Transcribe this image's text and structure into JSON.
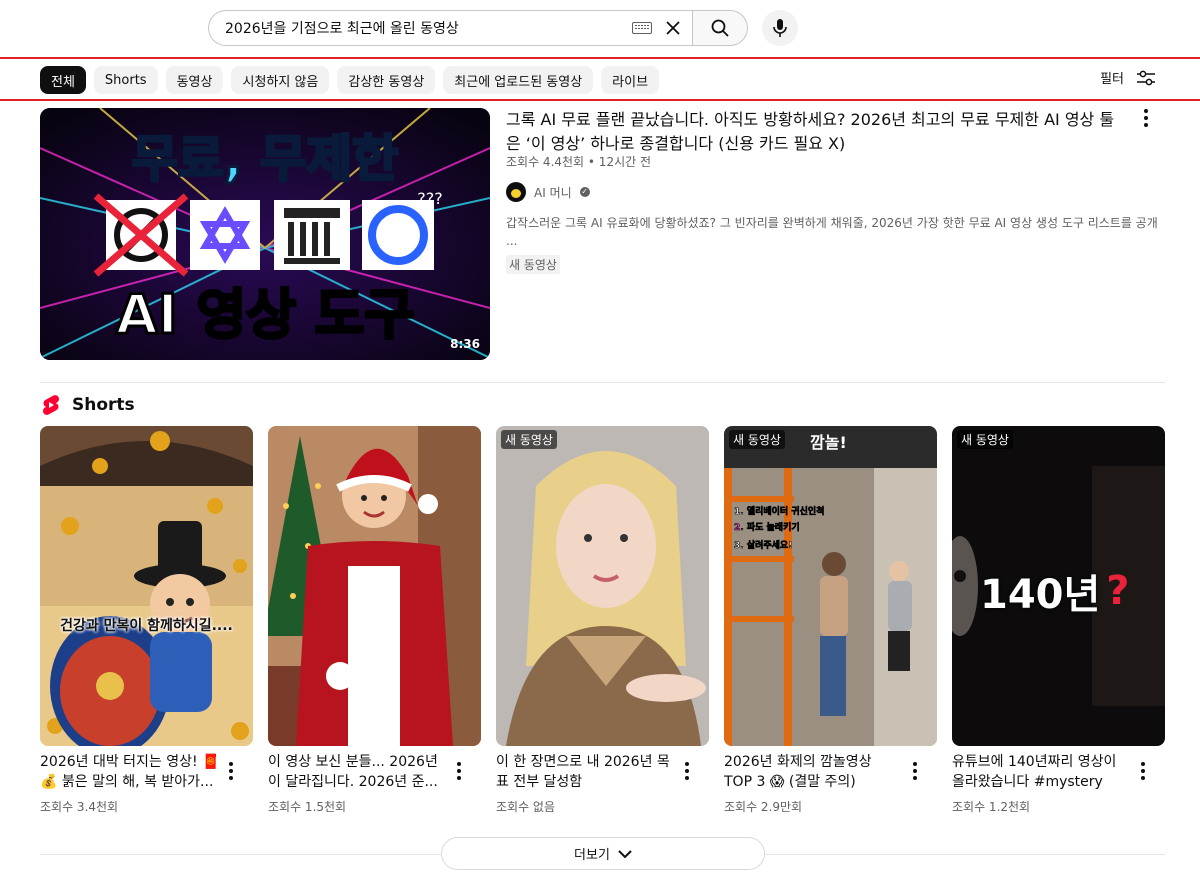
{
  "search": {
    "query": "2026년을 기점으로 최근에 올린 동영상"
  },
  "chips": [
    {
      "label": "전체"
    },
    {
      "label": "Shorts"
    },
    {
      "label": "동영상"
    },
    {
      "label": "시청하지 않음"
    },
    {
      "label": "감상한 동영상"
    },
    {
      "label": "최근에 업로드된 동영상"
    },
    {
      "label": "라이브"
    }
  ],
  "filter_label": "필터",
  "video": {
    "thumb_text_top": "무료, 무제한",
    "thumb_text_bottom": "AI 영상 도구",
    "thumb_question": "???",
    "duration": "8:36",
    "title": "그록 AI 무료 플랜 끝났습니다. 아직도 방황하세요? 2026년 최고의 무료 무제한 AI 영상 툴은 ‘이 영상’ 하나로 종결합니다 (신용 카드 필요 X)",
    "meta": "조회수 4.4천회 • 12시간 전",
    "channel": "AI 머니",
    "description": "갑작스러운 그록 AI 유료화에 당황하셨죠? 그 빈자리를 완벽하게 채워줄, 2026년 가장 핫한 무료 AI 영상 생성 도구 리스트를 공개 ...",
    "badge": "새 동영상"
  },
  "shorts_heading": "Shorts",
  "shorts": [
    {
      "title": "2026년 대박 터지는 영상! 🧧💰 붉은 말의 해, 복 받아가...",
      "views": "조회수 3.4천회",
      "overlay": "건강과 만복이 함께하시길....",
      "badge": ""
    },
    {
      "title": "이 영상 보신 분들... 2026년이 달라집니다. 2026년 준...",
      "views": "조회수 1.5천회",
      "overlay": "",
      "badge": ""
    },
    {
      "title": "이 한 장면으로 내 2026년 목표 전부 달성함",
      "views": "조회수 없음",
      "overlay": "",
      "badge": "새 동영상"
    },
    {
      "title": "2026년 화제의 깜놀영상 TOP 3 😱 (결말 주의)",
      "views": "조회수 2.9만회",
      "overlay": "깜놀!",
      "badge": "새 동영상"
    },
    {
      "title": "유튜브에 140년짜리 영상이 올라왔습니다 #mystery #...",
      "views": "조회수 1.2천회",
      "overlay": "140년",
      "badge": "새 동영상"
    }
  ],
  "more_label": "더보기"
}
